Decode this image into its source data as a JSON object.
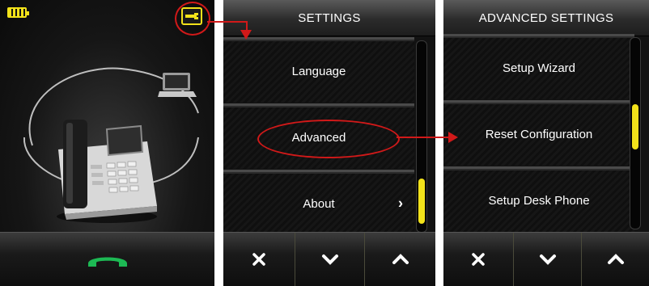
{
  "home": {
    "battery_icon": "battery-icon",
    "settings_icon": "wrench-icon",
    "laptop_icon": "laptop-icon",
    "phone_image": "desk-phone-image",
    "call_icon": "phone-handset-icon",
    "accent_green": "#1db954"
  },
  "settings": {
    "title": "SETTINGS",
    "items": [
      {
        "label": "Language"
      },
      {
        "label": "Advanced"
      },
      {
        "label": "About",
        "chevron": "›"
      }
    ],
    "scroll_position": 0.85,
    "buttons": [
      "close-icon",
      "chevron-down-icon",
      "chevron-up-icon"
    ]
  },
  "advanced": {
    "title": "ADVANCED SETTINGS",
    "items": [
      {
        "label": "Setup Wizard"
      },
      {
        "label": "Reset Configuration"
      },
      {
        "label": "Setup Desk Phone"
      }
    ],
    "scroll_position": 0.4,
    "buttons": [
      "close-icon",
      "chevron-down-icon",
      "chevron-up-icon"
    ]
  },
  "colors": {
    "accent_yellow": "#f2e21a",
    "annotation_red": "#d11919"
  }
}
